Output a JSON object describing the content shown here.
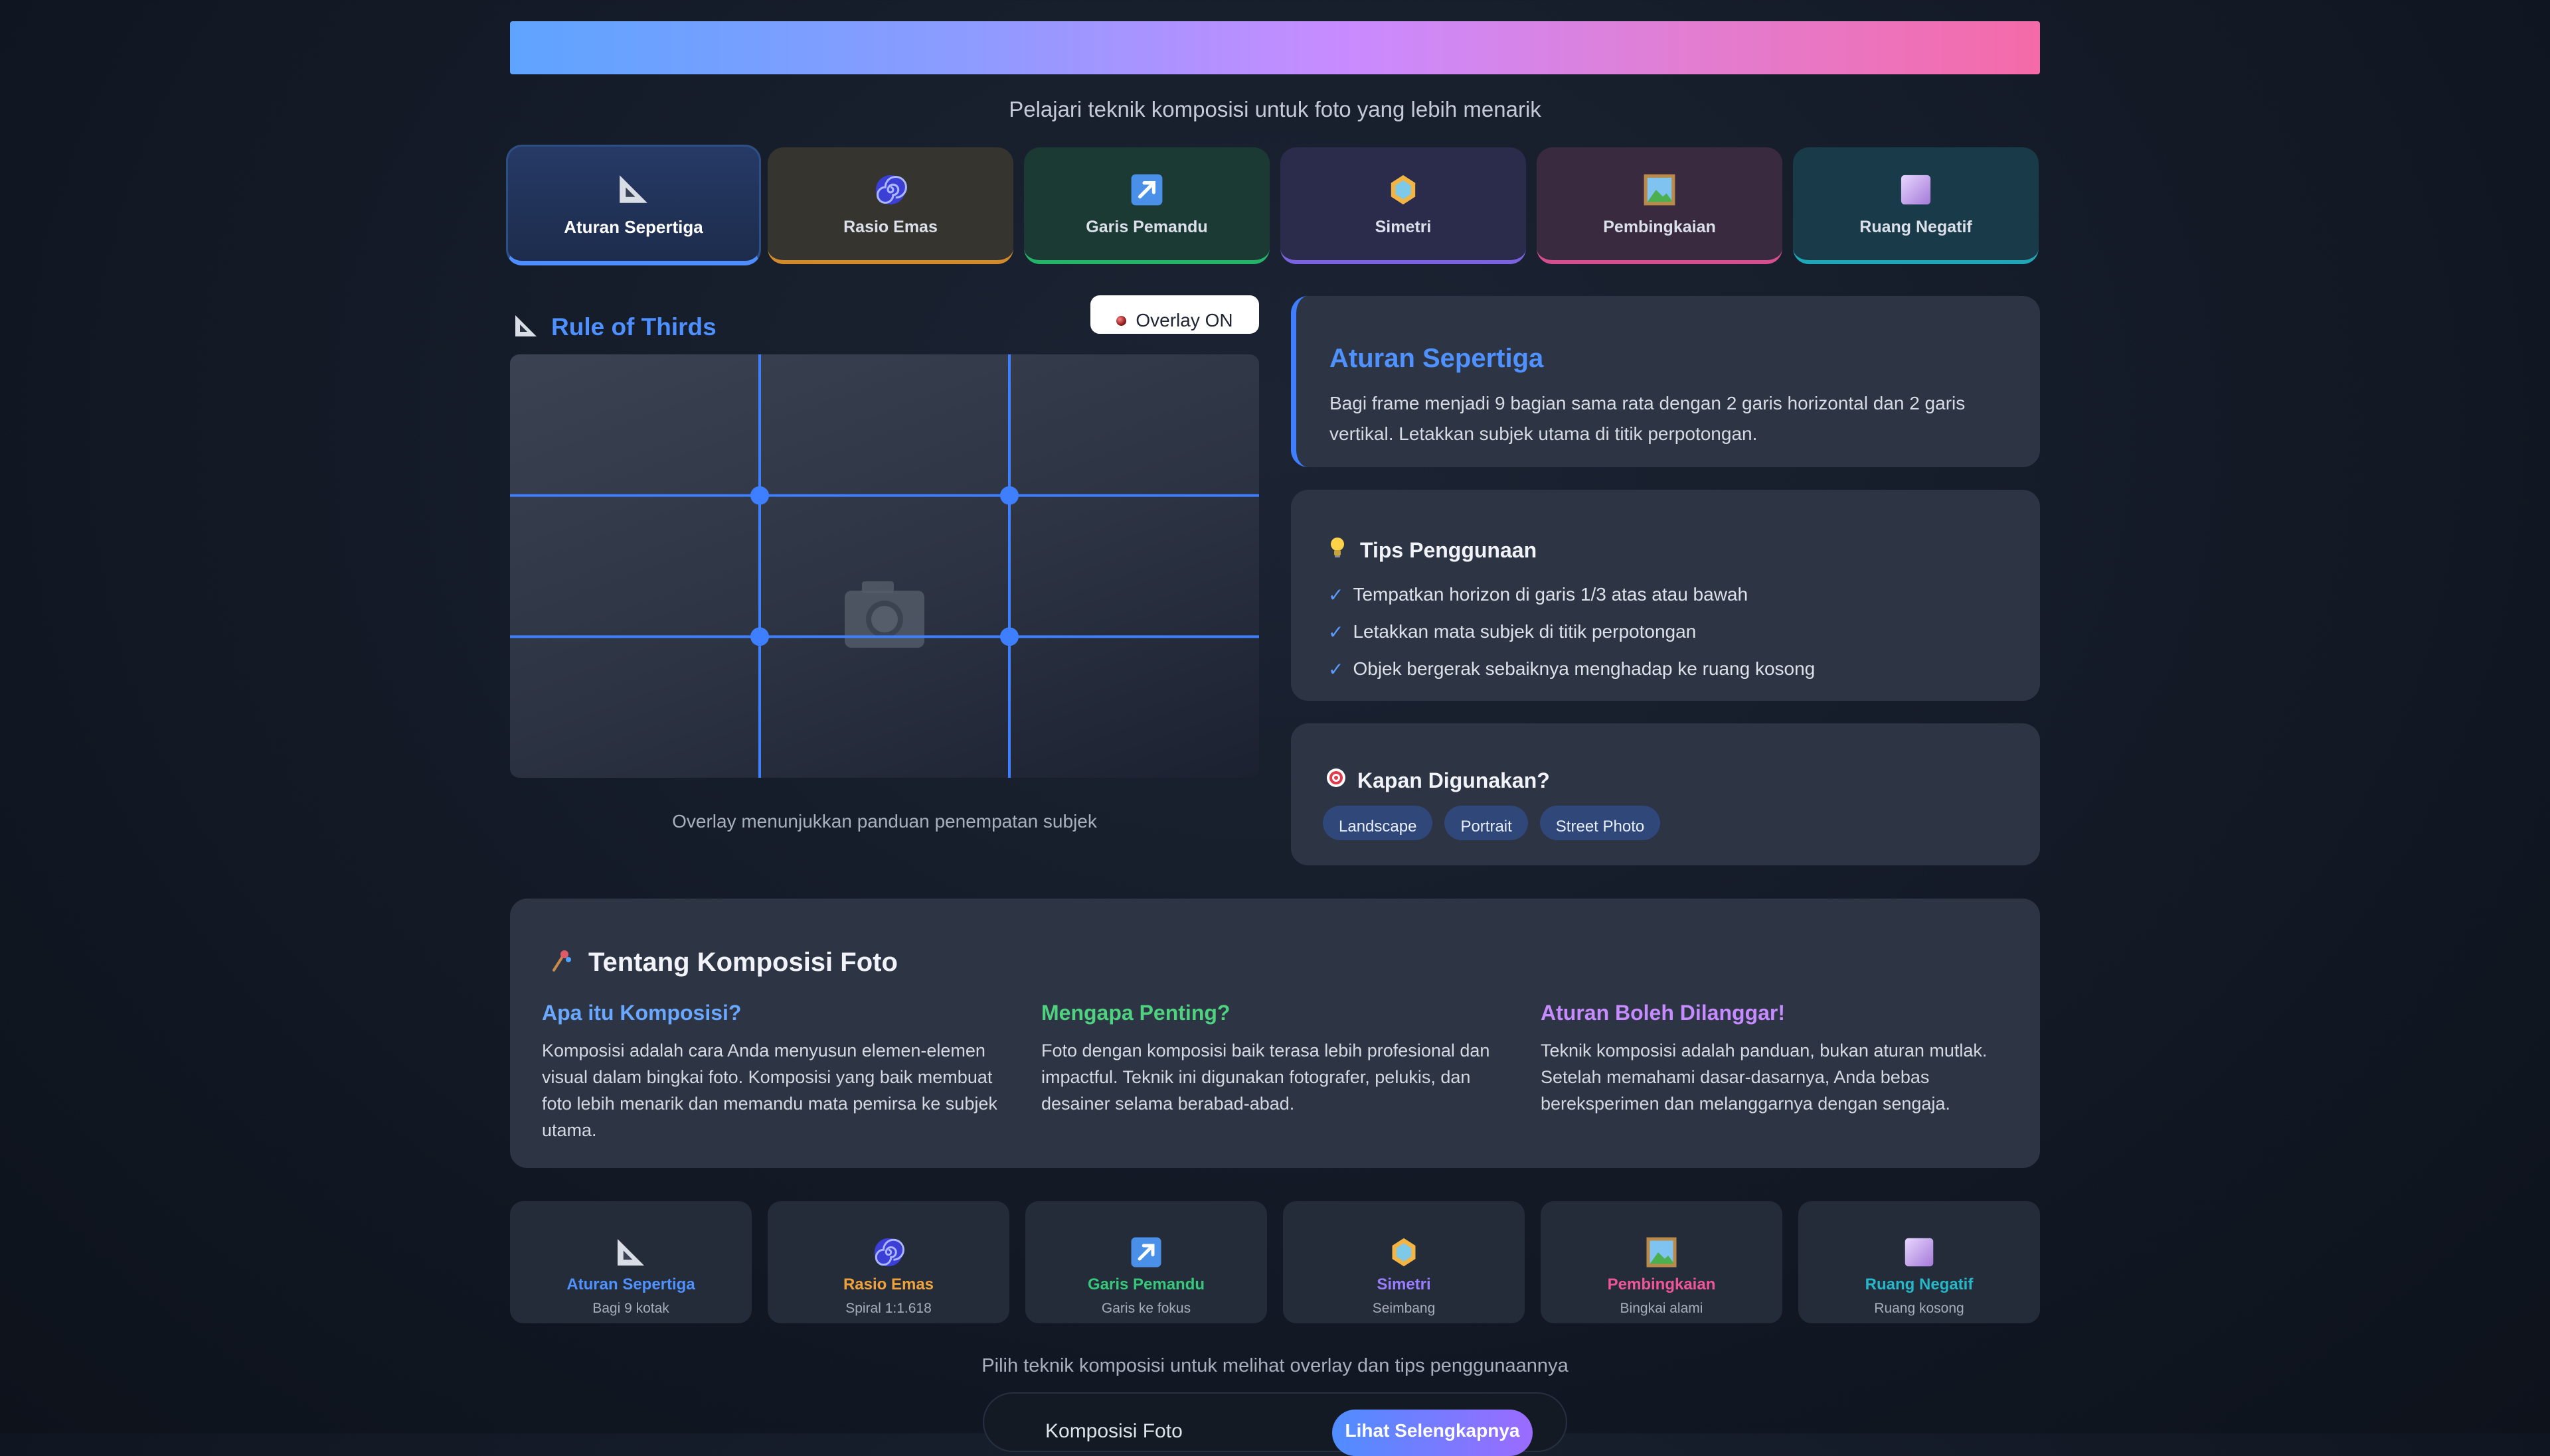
{
  "header": {
    "subtitle": "Pelajari teknik komposisi untuk foto yang lebih menarik"
  },
  "tabs": [
    {
      "label": "Aturan Sepertiga",
      "icon": "triangle-ruler-icon",
      "accent": "#4f8dff",
      "bg": "#263a66",
      "active": true
    },
    {
      "label": "Rasio Emas",
      "icon": "spiral-icon",
      "accent": "#d28a2a",
      "bg": "#35342e",
      "active": false
    },
    {
      "label": "Garis Pemandu",
      "icon": "arrow-up-right-icon",
      "accent": "#25b368",
      "bg": "#1b3a34",
      "active": false
    },
    {
      "label": "Simetri",
      "icon": "gem-icon",
      "accent": "#7b62e0",
      "bg": "#2b2b4b",
      "active": false
    },
    {
      "label": "Pembingkaian",
      "icon": "framed-picture-icon",
      "accent": "#d54f8e",
      "bg": "#3a2a40",
      "active": false
    },
    {
      "label": "Ruang Negatif",
      "icon": "square-icon",
      "accent": "#1fa7b8",
      "bg": "#193a48",
      "active": false
    }
  ],
  "preview": {
    "title": "Rule of Thirds",
    "overlay_label": "Overlay ON",
    "caption": "Overlay menunjukkan panduan penempatan subjek",
    "grid_color": "#3d7fff"
  },
  "info": {
    "title": "Aturan Sepertiga",
    "description": "Bagi frame menjadi 9 bagian sama rata dengan 2 garis horizontal dan 2 garis vertikal. Letakkan subjek utama di titik perpotongan."
  },
  "tips": {
    "title": "Tips Penggunaan",
    "items": [
      "Tempatkan horizon di garis 1/3 atas atau bawah",
      "Letakkan mata subjek di titik perpotongan",
      "Objek bergerak sebaiknya menghadap ke ruang kosong"
    ]
  },
  "when": {
    "title": "Kapan Digunakan?",
    "chips": [
      "Landscape",
      "Portrait",
      "Street Photo"
    ]
  },
  "about": {
    "title": "Tentang Komposisi Foto",
    "columns": [
      {
        "heading": "Apa itu Komposisi?",
        "color": "#6aa8ff",
        "text": "Komposisi adalah cara Anda menyusun elemen-elemen visual dalam bingkai foto. Komposisi yang baik membuat foto lebih menarik dan memandu mata pemirsa ke subjek utama."
      },
      {
        "heading": "Mengapa Penting?",
        "color": "#4fd27f",
        "text": "Foto dengan komposisi baik terasa lebih profesional dan impactful. Teknik ini digunakan fotografer, pelukis, dan desainer selama berabad-abad."
      },
      {
        "heading": "Aturan Boleh Dilanggar!",
        "color": "#c58bff",
        "text": "Teknik komposisi adalah panduan, bukan aturan mutlak. Setelah memahami dasar-dasarnya, Anda bebas bereksperimen dan melanggarnya dengan sengaja."
      }
    ]
  },
  "mini_cards": [
    {
      "name": "Aturan Sepertiga",
      "sub": "Bagi 9 kotak",
      "color": "#4f92ff",
      "icon": "triangle-ruler-icon"
    },
    {
      "name": "Rasio Emas",
      "sub": "Spiral 1:1.618",
      "color": "#f0a23a",
      "icon": "spiral-icon"
    },
    {
      "name": "Garis Pemandu",
      "sub": "Garis ke fokus",
      "color": "#36c77a",
      "icon": "arrow-up-right-icon"
    },
    {
      "name": "Simetri",
      "sub": "Seimbang",
      "color": "#9a7dff",
      "icon": "gem-icon"
    },
    {
      "name": "Pembingkaian",
      "sub": "Bingkai alami",
      "color": "#f0559b",
      "icon": "framed-picture-icon"
    },
    {
      "name": "Ruang Negatif",
      "sub": "Ruang kosong",
      "color": "#26b7c9",
      "icon": "square-icon"
    }
  ],
  "footer": {
    "hint": "Pilih teknik komposisi untuk melihat overlay dan tips penggunaannya",
    "left_text": "Komposisi Foto",
    "button_label": "Lihat Selengkapnya"
  }
}
